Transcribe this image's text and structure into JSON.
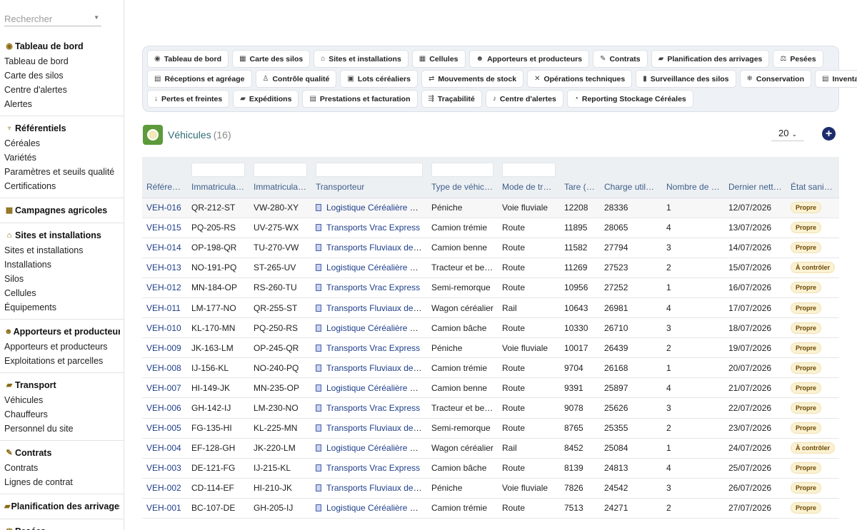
{
  "sidebar": {
    "search_placeholder": "Rechercher",
    "sections": [
      {
        "title": "Tableau de bord",
        "icon": "gauge-icon",
        "glyph": "◉",
        "items": [
          "Tableau de bord",
          "Carte des silos",
          "Centre d'alertes",
          "Alertes"
        ]
      },
      {
        "title": "Référentiels",
        "icon": "sprout-icon",
        "glyph": "♆",
        "items": [
          "Céréales",
          "Variétés",
          "Paramètres et seuils qualité",
          "Certifications"
        ]
      },
      {
        "title": "Campagnes agricoles",
        "icon": "calendar-icon",
        "glyph": "▦",
        "items": []
      },
      {
        "title": "Sites et installations",
        "icon": "warehouse-icon",
        "glyph": "⌂",
        "items": [
          "Sites et installations",
          "Installations",
          "Silos",
          "Cellules",
          "Équipements"
        ]
      },
      {
        "title": "Apporteurs et producteurs",
        "icon": "users-icon",
        "glyph": "☻",
        "items": [
          "Apporteurs et producteurs",
          "Exploitations et parcelles"
        ]
      },
      {
        "title": "Transport",
        "icon": "truck-icon",
        "glyph": "▰",
        "items": [
          "Véhicules",
          "Chauffeurs",
          "Personnel du site"
        ]
      },
      {
        "title": "Contrats",
        "icon": "contract-icon",
        "glyph": "✎",
        "items": [
          "Contrats",
          "Lignes de contrat"
        ]
      },
      {
        "title": "Planification des arrivages",
        "icon": "truck-loading-icon",
        "glyph": "▰",
        "items": []
      },
      {
        "title": "Pesées",
        "icon": "scale-icon",
        "glyph": "⚖",
        "items": []
      }
    ]
  },
  "nav": {
    "rows": [
      [
        {
          "label": "Tableau de bord",
          "icon": "gauge-icon",
          "glyph": "◉"
        },
        {
          "label": "Carte des silos",
          "icon": "grid-icon",
          "glyph": "▦"
        },
        {
          "label": "Sites et installations",
          "icon": "warehouse-icon",
          "glyph": "⌂"
        },
        {
          "label": "Cellules",
          "icon": "grid-icon",
          "glyph": "▦"
        },
        {
          "label": "Apporteurs et producteurs",
          "icon": "users-icon",
          "glyph": "☻"
        },
        {
          "label": "Contrats",
          "icon": "contract-icon",
          "glyph": "✎"
        },
        {
          "label": "Planification des arrivages",
          "icon": "truck-loading-icon",
          "glyph": "▰"
        },
        {
          "label": "Pesées",
          "icon": "scale-icon",
          "glyph": "⚖"
        }
      ],
      [
        {
          "label": "Réceptions et agréage",
          "icon": "clipboard-icon",
          "glyph": "▤"
        },
        {
          "label": "Contrôle qualité",
          "icon": "flask-icon",
          "glyph": "♙"
        },
        {
          "label": "Lots céréaliers",
          "icon": "box-icon",
          "glyph": "▣"
        },
        {
          "label": "Mouvements de stock",
          "icon": "exchange-icon",
          "glyph": "⇄"
        },
        {
          "label": "Opérations techniques",
          "icon": "tools-icon",
          "glyph": "✕"
        },
        {
          "label": "Surveillance des silos",
          "icon": "thermometer-icon",
          "glyph": "▮"
        },
        {
          "label": "Conservation",
          "icon": "snowflake-icon",
          "glyph": "❄"
        },
        {
          "label": "Inventaires",
          "icon": "list-icon",
          "glyph": "▤"
        }
      ],
      [
        {
          "label": "Pertes et freintes",
          "icon": "arrow-down-icon",
          "glyph": "↓"
        },
        {
          "label": "Expéditions",
          "icon": "truck-icon",
          "glyph": "▰"
        },
        {
          "label": "Prestations et facturation",
          "icon": "invoice-icon",
          "glyph": "▤"
        },
        {
          "label": "Traçabilité",
          "icon": "route-icon",
          "glyph": "⇶"
        },
        {
          "label": "Centre d'alertes",
          "icon": "bell-icon",
          "glyph": "♪"
        },
        {
          "label": "Reporting Stockage Céréales",
          "icon": "chart-pie-icon",
          "glyph": "◔"
        }
      ]
    ]
  },
  "list": {
    "title": "Véhicules",
    "count": "(16)",
    "page_size": "20",
    "add_label": "+"
  },
  "table": {
    "columns": [
      {
        "label": "Référence",
        "width": 63,
        "filter": false
      },
      {
        "label": "Immatriculation",
        "width": 87,
        "filter": true
      },
      {
        "label": "Immatriculation remorque",
        "width": 87,
        "filter": true
      },
      {
        "label": "Transporteur",
        "width": 162,
        "filter": true
      },
      {
        "label": "Type de véhicule",
        "width": 99,
        "filter": true
      },
      {
        "label": "Mode de transport",
        "width": 87,
        "filter": true
      },
      {
        "label": "Tare (kg)",
        "width": 56,
        "filter": false
      },
      {
        "label": "Charge utile (kg)",
        "width": 87,
        "filter": false
      },
      {
        "label": "Nombre de compartiments",
        "width": 87,
        "filter": false
      },
      {
        "label": "Dernier nettoyage",
        "width": 87,
        "filter": false
      },
      {
        "label": "État sanitaire",
        "width": 74,
        "filter": false
      }
    ],
    "rows": [
      [
        "VEH-016",
        "QR-212-ST",
        "VW-280-XY",
        "Logistique Céréalière du Centre",
        "Péniche",
        "Voie fluviale",
        "12208",
        "28336",
        "1",
        "12/07/2026",
        "Propre"
      ],
      [
        "VEH-015",
        "PQ-205-RS",
        "UV-275-WX",
        "Transports Vrac Express",
        "Camion trémie",
        "Route",
        "11895",
        "28065",
        "4",
        "13/07/2026",
        "Propre"
      ],
      [
        "VEH-014",
        "OP-198-QR",
        "TU-270-VW",
        "Transports Fluviaux de Seine",
        "Camion benne",
        "Route",
        "11582",
        "27794",
        "3",
        "14/07/2026",
        "Propre"
      ],
      [
        "VEH-013",
        "NO-191-PQ",
        "ST-265-UV",
        "Logistique Céréalière du Centre",
        "Tracteur et benne",
        "Route",
        "11269",
        "27523",
        "2",
        "15/07/2026",
        "À contrôler"
      ],
      [
        "VEH-012",
        "MN-184-OP",
        "RS-260-TU",
        "Transports Vrac Express",
        "Semi-remorque",
        "Route",
        "10956",
        "27252",
        "1",
        "16/07/2026",
        "Propre"
      ],
      [
        "VEH-011",
        "LM-177-NO",
        "QR-255-ST",
        "Transports Fluviaux de Seine",
        "Wagon céréalier",
        "Rail",
        "10643",
        "26981",
        "4",
        "17/07/2026",
        "Propre"
      ],
      [
        "VEH-010",
        "KL-170-MN",
        "PQ-250-RS",
        "Logistique Céréalière du Centre",
        "Camion bâche",
        "Route",
        "10330",
        "26710",
        "3",
        "18/07/2026",
        "Propre"
      ],
      [
        "VEH-009",
        "JK-163-LM",
        "OP-245-QR",
        "Transports Vrac Express",
        "Péniche",
        "Voie fluviale",
        "10017",
        "26439",
        "2",
        "19/07/2026",
        "Propre"
      ],
      [
        "VEH-008",
        "IJ-156-KL",
        "NO-240-PQ",
        "Transports Fluviaux de Seine",
        "Camion trémie",
        "Route",
        "9704",
        "26168",
        "1",
        "20/07/2026",
        "Propre"
      ],
      [
        "VEH-007",
        "HI-149-JK",
        "MN-235-OP",
        "Logistique Céréalière du Centre",
        "Camion benne",
        "Route",
        "9391",
        "25897",
        "4",
        "21/07/2026",
        "Propre"
      ],
      [
        "VEH-006",
        "GH-142-IJ",
        "LM-230-NO",
        "Transports Vrac Express",
        "Tracteur et benne",
        "Route",
        "9078",
        "25626",
        "3",
        "22/07/2026",
        "Propre"
      ],
      [
        "VEH-005",
        "FG-135-HI",
        "KL-225-MN",
        "Transports Fluviaux de Seine",
        "Semi-remorque",
        "Route",
        "8765",
        "25355",
        "2",
        "23/07/2026",
        "Propre"
      ],
      [
        "VEH-004",
        "EF-128-GH",
        "JK-220-LM",
        "Logistique Céréalière du Centre",
        "Wagon céréalier",
        "Rail",
        "8452",
        "25084",
        "1",
        "24/07/2026",
        "À contrôler"
      ],
      [
        "VEH-003",
        "DE-121-FG",
        "IJ-215-KL",
        "Transports Vrac Express",
        "Camion bâche",
        "Route",
        "8139",
        "24813",
        "4",
        "25/07/2026",
        "Propre"
      ],
      [
        "VEH-002",
        "CD-114-EF",
        "HI-210-JK",
        "Transports Fluviaux de Seine",
        "Péniche",
        "Voie fluviale",
        "7826",
        "24542",
        "3",
        "26/07/2026",
        "Propre"
      ],
      [
        "VEH-001",
        "BC-107-DE",
        "GH-205-IJ",
        "Logistique Céréalière du Centre",
        "Camion trémie",
        "Route",
        "7513",
        "24271",
        "2",
        "27/07/2026",
        "Propre"
      ]
    ]
  }
}
